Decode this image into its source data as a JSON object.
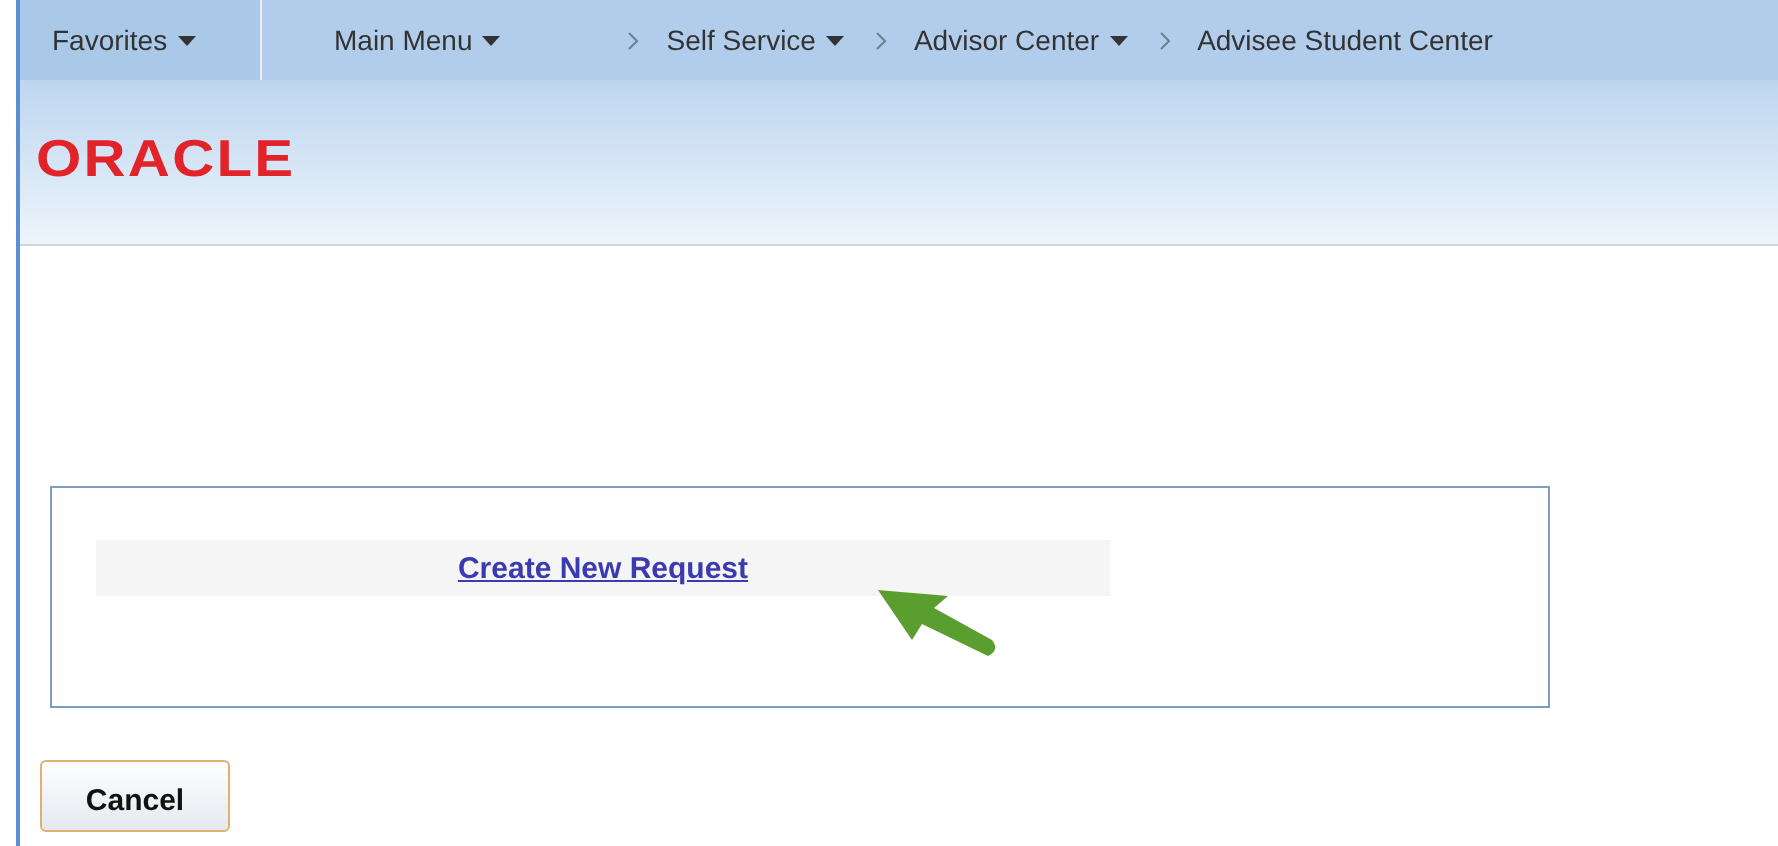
{
  "nav": {
    "favorites": {
      "label": "Favorites",
      "dropdown": true
    },
    "breadcrumbs": [
      {
        "label": "Main Menu",
        "dropdown": true
      },
      {
        "label": "Self Service",
        "dropdown": true
      },
      {
        "label": "Advisor Center",
        "dropdown": true
      },
      {
        "label": "Advisee Student Center",
        "dropdown": false
      }
    ]
  },
  "logo": {
    "text": "ORACLE"
  },
  "panel": {
    "link": "Create New Request"
  },
  "buttons": [
    {
      "label": "Cancel"
    }
  ]
}
